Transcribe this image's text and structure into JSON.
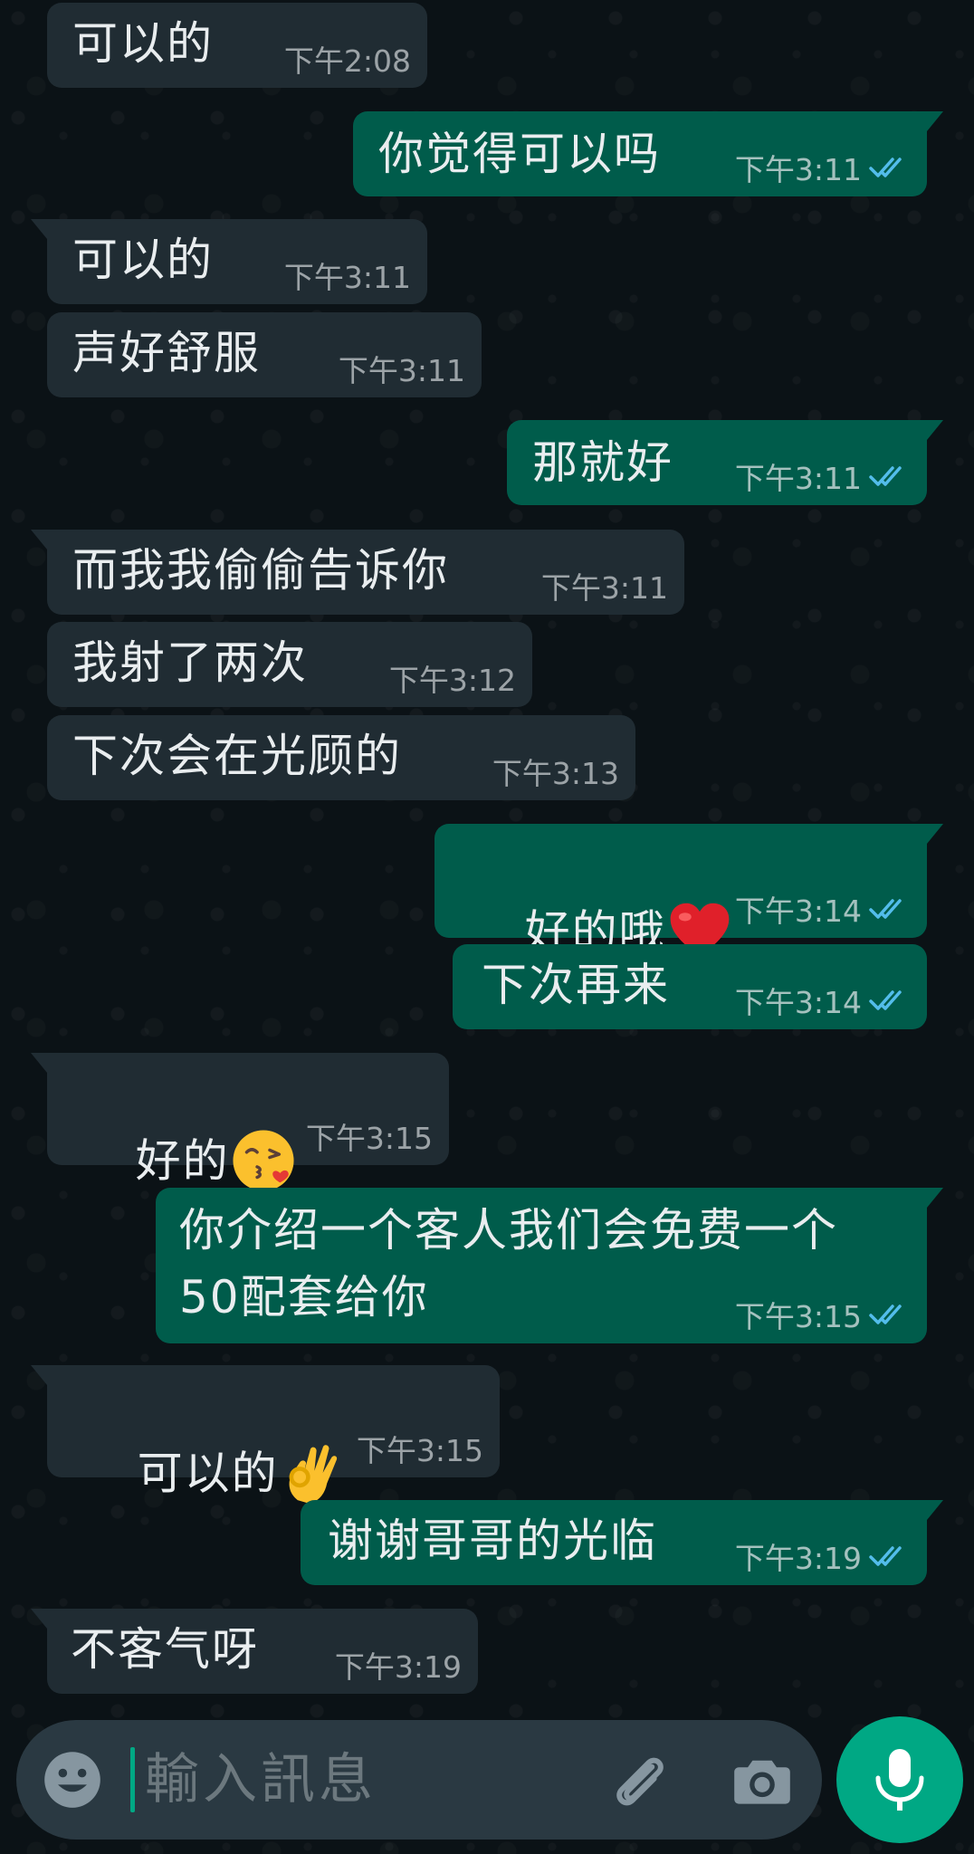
{
  "messages": [
    {
      "direction": "in",
      "text": "可以的",
      "time": "下午2:08"
    },
    {
      "direction": "out",
      "text": "你觉得可以吗",
      "time": "下午3:11",
      "status": "read"
    },
    {
      "direction": "in",
      "text": "可以的",
      "time": "下午3:11"
    },
    {
      "direction": "in",
      "text": "声好舒服",
      "time": "下午3:11"
    },
    {
      "direction": "out",
      "text": "那就好",
      "time": "下午3:11",
      "status": "read"
    },
    {
      "direction": "in",
      "text": "而我我偷偷告诉你",
      "time": "下午3:11"
    },
    {
      "direction": "in",
      "text": "我射了两次",
      "time": "下午3:12"
    },
    {
      "direction": "in",
      "text": "下次会在光顾的",
      "time": "下午3:13"
    },
    {
      "direction": "out",
      "text": "好的哦",
      "emoji": "red-heart-icon",
      "time": "下午3:14",
      "status": "read"
    },
    {
      "direction": "out",
      "text": "下次再来",
      "time": "下午3:14",
      "status": "read"
    },
    {
      "direction": "in",
      "text": "好的",
      "emoji": "face-blowing-kiss-icon",
      "time": "下午3:15"
    },
    {
      "direction": "out",
      "text": "你介绍一个客人我们会免费一个\n50配套给你",
      "time": "下午3:15",
      "status": "read"
    },
    {
      "direction": "in",
      "text": "可以的",
      "emoji": "ok-hand-icon",
      "time": "下午3:15"
    },
    {
      "direction": "out",
      "text": "谢谢哥哥的光临",
      "time": "下午3:19",
      "status": "read"
    },
    {
      "direction": "in",
      "text": "不客气呀",
      "time": "下午3:19"
    }
  ],
  "composer": {
    "placeholder": "輸入訊息",
    "icons": [
      "emoji-icon",
      "attach-icon",
      "camera-icon",
      "mic-icon"
    ]
  },
  "colors": {
    "background": "#0b1216",
    "incoming_bubble": "#202c33",
    "outgoing_bubble": "#005c4b",
    "read_ticks": "#53bdeb",
    "accent": "#00a884"
  }
}
